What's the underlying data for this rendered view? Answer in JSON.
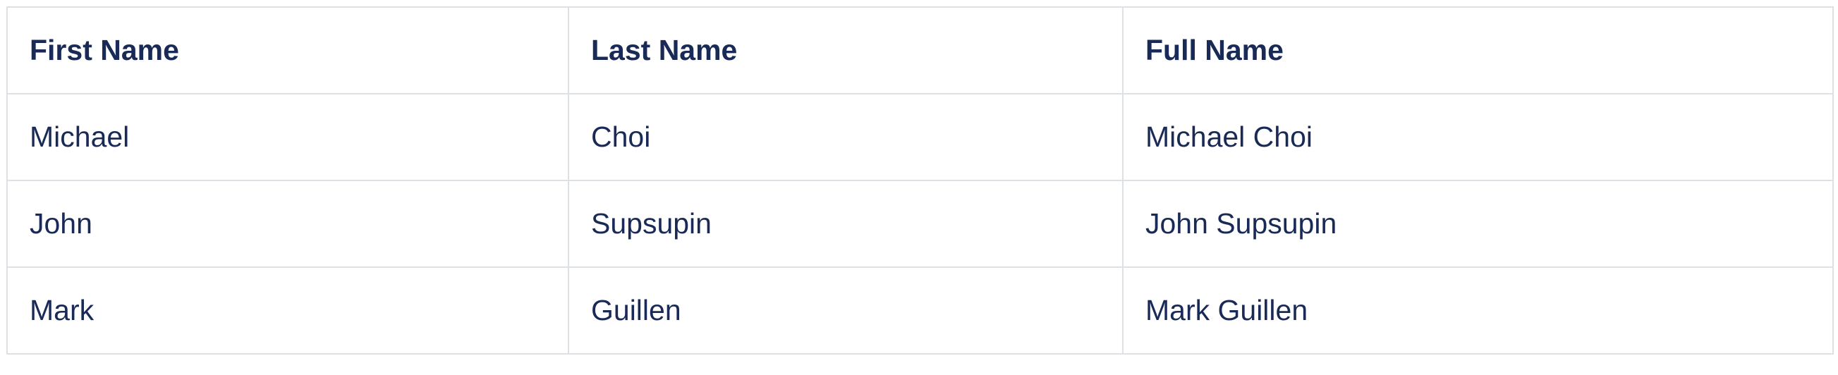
{
  "table": {
    "headers": [
      "First Name",
      "Last Name",
      "Full Name"
    ],
    "rows": [
      [
        "Michael",
        "Choi",
        "Michael Choi"
      ],
      [
        "John",
        "Supsupin",
        "John Supsupin"
      ],
      [
        "Mark",
        "Guillen",
        "Mark Guillen"
      ]
    ]
  },
  "colors": {
    "text": "#1a2a57",
    "border": "#dde1e6",
    "background": "#ffffff"
  }
}
